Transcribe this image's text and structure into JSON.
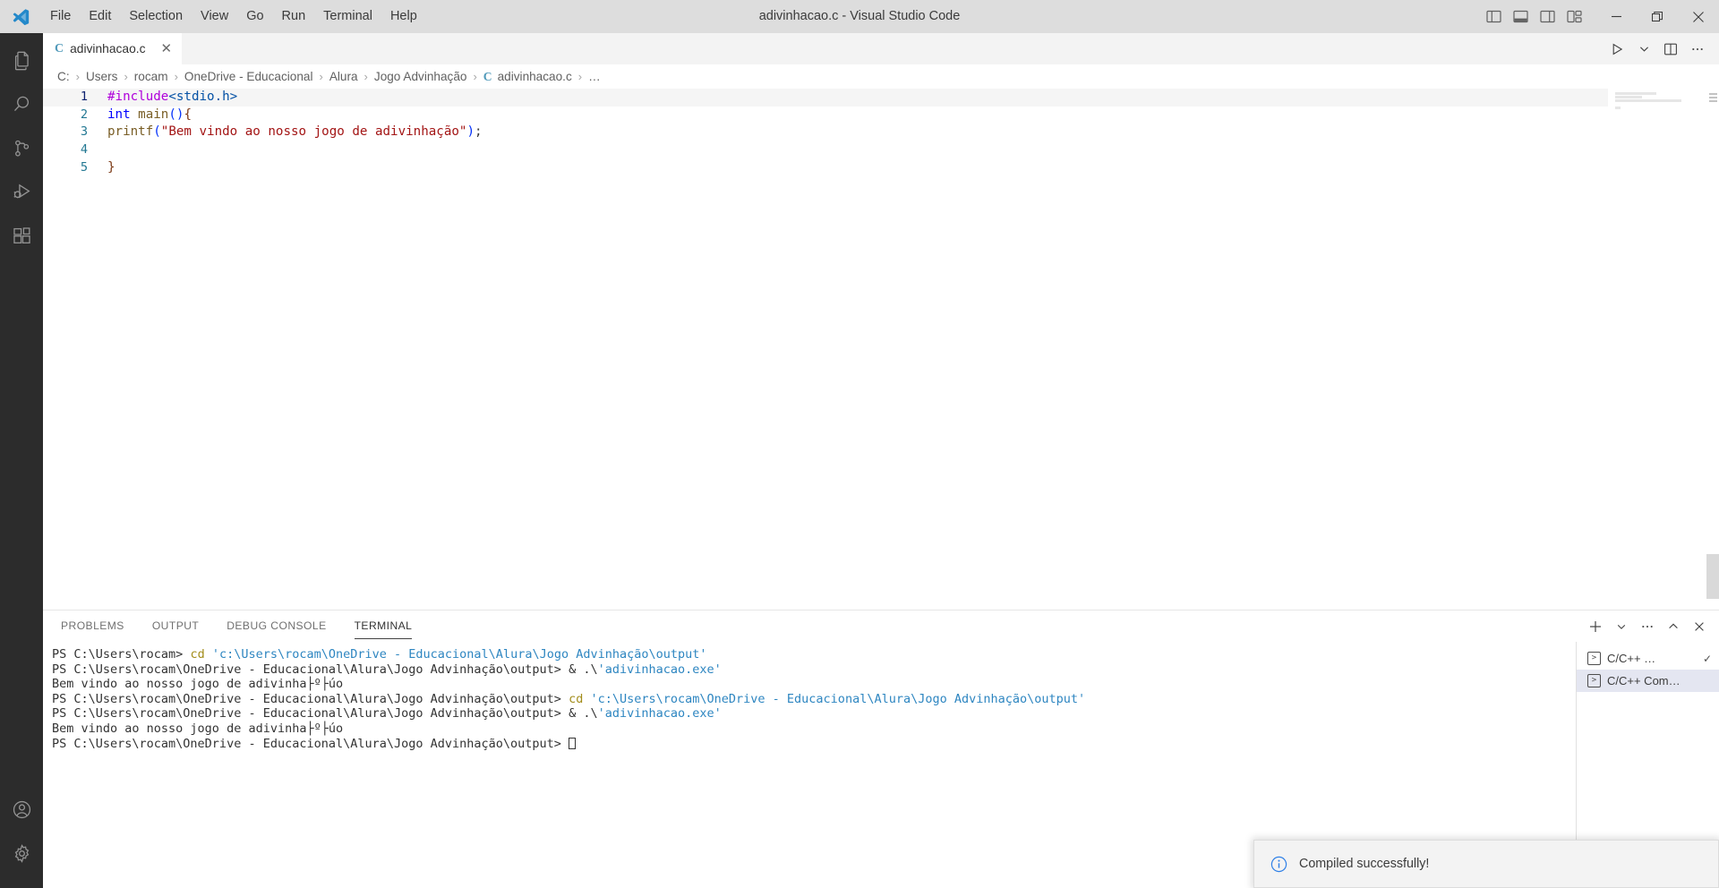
{
  "window": {
    "title": "adivinhacao.c - Visual Studio Code",
    "menus": [
      "File",
      "Edit",
      "Selection",
      "View",
      "Go",
      "Run",
      "Terminal",
      "Help"
    ],
    "layout_controls": [
      {
        "name": "toggle-primary-sidebar-icon",
        "label": "Toggle Primary Side Bar"
      },
      {
        "name": "toggle-panel-icon",
        "label": "Toggle Panel"
      },
      {
        "name": "toggle-secondary-sidebar-icon",
        "label": "Toggle Secondary Side Bar"
      },
      {
        "name": "customize-layout-icon",
        "label": "Customize Layout"
      }
    ],
    "window_controls": [
      {
        "name": "minimize-button",
        "glyph": "─"
      },
      {
        "name": "maximize-button",
        "glyph": "❐"
      },
      {
        "name": "close-button",
        "glyph": "✕"
      }
    ]
  },
  "activity_bar": {
    "items": [
      {
        "name": "explorer",
        "label": "Explorer"
      },
      {
        "name": "search",
        "label": "Search"
      },
      {
        "name": "source-control",
        "label": "Source Control"
      },
      {
        "name": "run-and-debug",
        "label": "Run and Debug"
      },
      {
        "name": "extensions",
        "label": "Extensions"
      }
    ],
    "bottom_items": [
      {
        "name": "accounts",
        "label": "Accounts"
      },
      {
        "name": "manage-settings",
        "label": "Manage"
      }
    ]
  },
  "editor": {
    "tab": {
      "label": "adivinhacao.c",
      "lang_badge": "C",
      "close_glyph": "✕"
    },
    "tab_actions": [
      {
        "name": "run-code-button",
        "label": "Run Code"
      },
      {
        "name": "run-options-chevron",
        "label": "Run or Debug..."
      },
      {
        "name": "split-editor-right-button",
        "label": "Split Editor Right"
      },
      {
        "name": "more-editor-actions-button",
        "label": "More Actions..."
      }
    ],
    "breadcrumb": {
      "parts": [
        "C:",
        "Users",
        "rocam",
        "OneDrive - Educacional",
        "Alura",
        "Jogo Advinhação"
      ],
      "file": "adivinhacao.c",
      "file_badge": "C",
      "trailing": "…",
      "separator": "›"
    },
    "active_line": 1,
    "lines": [
      {
        "n": "1",
        "tokens": [
          {
            "t": "#include",
            "c": "t-pre"
          },
          {
            "t": "<stdio.h>",
            "c": "t-hdr"
          }
        ]
      },
      {
        "n": "2",
        "tokens": [
          {
            "t": "int",
            "c": "t-kw"
          },
          {
            "t": " ",
            "c": "t-plain"
          },
          {
            "t": "main",
            "c": "t-fn"
          },
          {
            "t": "()",
            "c": "t-paren1"
          },
          {
            "t": "{",
            "c": "t-paren2"
          }
        ]
      },
      {
        "n": "3",
        "tokens": [
          {
            "t": "printf",
            "c": "t-fn"
          },
          {
            "t": "(",
            "c": "t-paren1"
          },
          {
            "t": "\"Bem vindo ao nosso jogo de adivinhação\"",
            "c": "t-str"
          },
          {
            "t": ")",
            "c": "t-paren1"
          },
          {
            "t": ";",
            "c": "t-plain"
          }
        ]
      },
      {
        "n": "4",
        "tokens": []
      },
      {
        "n": "5",
        "tokens": [
          {
            "t": "}",
            "c": "t-paren2"
          }
        ]
      }
    ]
  },
  "panel": {
    "tabs": [
      {
        "label": "PROBLEMS",
        "active": false
      },
      {
        "label": "OUTPUT",
        "active": false
      },
      {
        "label": "DEBUG CONSOLE",
        "active": false
      },
      {
        "label": "TERMINAL",
        "active": true
      }
    ],
    "actions": [
      {
        "name": "new-terminal-button",
        "label": "+"
      },
      {
        "name": "terminal-profile-chevron-icon",
        "label": "Launch Profile..."
      },
      {
        "name": "panel-views-and-more-actions-button",
        "label": "…"
      },
      {
        "name": "maximize-panel-size-button",
        "label": "^"
      },
      {
        "name": "close-panel-button",
        "label": "✕"
      }
    ],
    "terminal": {
      "lines": [
        [
          {
            "t": "PS C:\\Users\\rocam> ",
            "c": "tm-prompt"
          },
          {
            "t": "cd ",
            "c": "tm-cmd"
          },
          {
            "t": "'c:\\Users\\rocam\\OneDrive - Educacional\\Alura\\Jogo Advinhação\\output'",
            "c": "tm-path"
          }
        ],
        [
          {
            "t": "PS C:\\Users\\rocam\\OneDrive - Educacional\\Alura\\Jogo Advinhação\\output> ",
            "c": "tm-prompt"
          },
          {
            "t": "& ",
            "c": "tm-amp"
          },
          {
            "t": ".\\",
            "c": "tm-amp"
          },
          {
            "t": "'adivinhacao.exe'",
            "c": "tm-path"
          }
        ],
        [
          {
            "t": "Bem vindo ao nosso jogo de adivinha├º├úo",
            "c": "tm-prompt"
          }
        ],
        [
          {
            "t": "PS C:\\Users\\rocam\\OneDrive - Educacional\\Alura\\Jogo Advinhação\\output> ",
            "c": "tm-prompt"
          },
          {
            "t": "cd ",
            "c": "tm-cmd"
          },
          {
            "t": "'c:\\Users\\rocam\\OneDrive - Educacional\\Alura\\Jogo Advinhação\\output'",
            "c": "tm-path"
          }
        ],
        [
          {
            "t": "PS C:\\Users\\rocam\\OneDrive - Educacional\\Alura\\Jogo Advinhação\\output> ",
            "c": "tm-prompt"
          },
          {
            "t": "& ",
            "c": "tm-amp"
          },
          {
            "t": ".\\",
            "c": "tm-amp"
          },
          {
            "t": "'adivinhacao.exe'",
            "c": "tm-path"
          }
        ],
        [
          {
            "t": "Bem vindo ao nosso jogo de adivinha├º├úo",
            "c": "tm-prompt"
          }
        ],
        [
          {
            "t": "PS C:\\Users\\rocam\\OneDrive - Educacional\\Alura\\Jogo Advinhação\\output> ",
            "c": "tm-prompt"
          }
        ]
      ]
    },
    "terminal_list": [
      {
        "label": "C/C++ …",
        "icon": ">",
        "selected": false,
        "check": "✓"
      },
      {
        "label": "C/C++ Com…",
        "icon": ">",
        "selected": true,
        "check": ""
      }
    ]
  },
  "notification": {
    "icon": "info-icon",
    "message": "Compiled successfully!"
  },
  "colors": {
    "titlebar_bg": "#dddddd",
    "activitybar_bg": "#2c2c2c",
    "editor_bg": "#ffffff",
    "accent_blue": "#0078d4",
    "lineno": "#237893",
    "string": "#a31515",
    "keyword": "#0000ff",
    "preproc": "#af00db",
    "function": "#795e26",
    "terminal_path": "#2e86c1",
    "terminal_cmd": "#a28c19",
    "selection_bg": "#e4e6f1"
  }
}
